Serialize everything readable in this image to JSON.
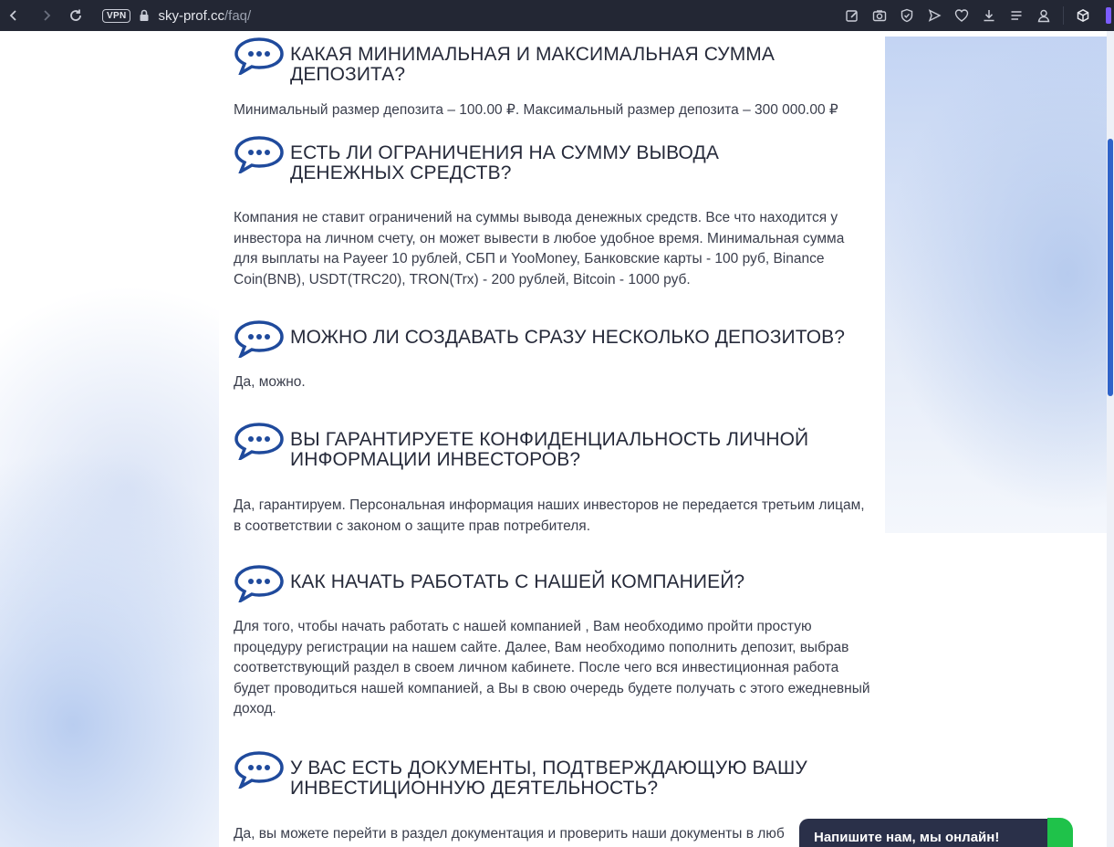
{
  "browser": {
    "vpn_label": "VPN",
    "url_domain": "sky-prof.cc",
    "url_path": "/faq/"
  },
  "faq": [
    {
      "question": "КАКАЯ МИНИМАЛЬНАЯ И МАКСИМАЛЬНАЯ СУММА ДЕПОЗИТА?",
      "answer": "Минимальный размер депозита – 100.00 ₽. Максимальный размер депозита – 300 000.00 ₽"
    },
    {
      "question": "ЕСТЬ ЛИ ОГРАНИЧЕНИЯ НА СУММУ ВЫВОДА ДЕНЕЖНЫХ СРЕДСТВ?",
      "answer": "Компания не ставит ограничений на суммы вывода денежных средств. Все что находится у инвестора на личном счету, он может вывести в любое удобное время. Минимальная сумма для выплаты на Payeer 10 рублей, СБП и YooMoney, Банковские карты - 100 руб, Binance Coin(BNB), USDT(TRC20), TRON(Trx) - 200 рублей, Bitcoin - 1000 руб."
    },
    {
      "question": "МОЖНО ЛИ СОЗДАВАТЬ СРАЗУ НЕСКОЛЬКО ДЕПОЗИТОВ?",
      "answer": "Да, можно."
    },
    {
      "question": "ВЫ ГАРАНТИРУЕТЕ КОНФИДЕНЦИАЛЬНОСТЬ ЛИЧНОЙ ИНФОРМАЦИИ ИНВЕСТОРОВ?",
      "answer": "Да, гарантируем. Персональная информация наших инвесторов не передается третьим лицам, в соответствии с законом о защите прав потребителя."
    },
    {
      "question": "КАК НАЧАТЬ РАБОТАТЬ С НАШЕЙ КОМПАНИЕЙ?",
      "answer": "Для того, чтобы начать работать с нашей компанией , Вам необходимо пройти простую процедуру регистрации на нашем сайте. Далее, Вам необходимо пополнить депозит, выбрав соответствующий раздел в своем личном кабинете. После чего вся инвестиционная работа будет проводиться нашей компанией, а Вы в свою очередь будете получать с этого ежедневный доход."
    },
    {
      "question": "У ВАС ЕСТЬ ДОКУМЕНТЫ, ПОДТВЕРЖДАЮЩУЮ ВАШУ ИНВЕСТИЦИОННУЮ ДЕЯТЕЛЬНОСТЬ?",
      "answer": "Да, вы можете перейти в раздел документация и проверить наши документы в люб"
    }
  ],
  "chat": {
    "label": "Напишите нам, мы онлайн!"
  },
  "colors": {
    "bubble": "#1f4a9c",
    "chrome": "#232734",
    "chat": "#2a3049",
    "chat_online": "#1fc24a",
    "scrollbar": "#2f63c9"
  }
}
